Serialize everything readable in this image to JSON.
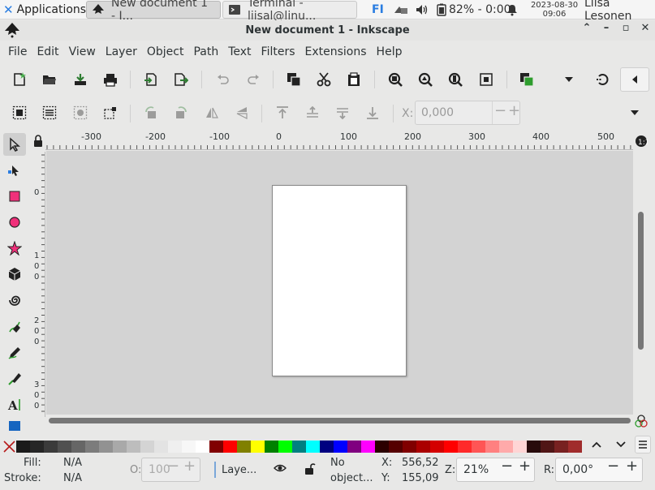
{
  "panel": {
    "apps_label": "Applications",
    "tasks": [
      {
        "label": "New document 1 - I...",
        "active": true
      },
      {
        "label": "Terminal - liisal@linu...",
        "active": false
      }
    ],
    "keyboard_layout": "FI",
    "battery": "82% - 0:00",
    "clock_date": "2023-08-30",
    "clock_time": "09:06",
    "user": "Liisa Lesonen"
  },
  "window": {
    "title": "New document 1 - Inkscape"
  },
  "menubar": [
    "File",
    "Edit",
    "View",
    "Layer",
    "Object",
    "Path",
    "Text",
    "Filters",
    "Extensions",
    "Help"
  ],
  "toolbar2": {
    "x_label": "X:",
    "x_value": "0,000"
  },
  "ruler": {
    "h_ticks": [
      "-300",
      "-200",
      "-100",
      "0",
      "100",
      "200",
      "300",
      "400",
      "500"
    ],
    "v_ticks": [
      "0",
      "1\n0\n0",
      "2\n0\n0",
      "3\n0\n0"
    ]
  },
  "palette": {
    "colors": [
      "#1a1a1a",
      "#262626",
      "#3b3b3b",
      "#505050",
      "#666666",
      "#7c7c7c",
      "#929292",
      "#a9a9a9",
      "#bdbdbd",
      "#d4d4d4",
      "#e3e3e3",
      "#efefef",
      "#f7f7f7",
      "#ffffff",
      "#800000",
      "#ff0000",
      "#808000",
      "#ffff00",
      "#008000",
      "#00ff00",
      "#008080",
      "#00ffff",
      "#000080",
      "#0000ff",
      "#800080",
      "#ff00ff",
      "#2b0000",
      "#550000",
      "#800000",
      "#aa0000",
      "#d40000",
      "#ff0000",
      "#ff2a2a",
      "#ff5555",
      "#ff8080",
      "#ffaaaa",
      "#ffd5d5",
      "#280b0b",
      "#501616",
      "#782121",
      "#a02c2c"
    ]
  },
  "status": {
    "fill_label": "Fill:",
    "fill_value": "N/A",
    "stroke_label": "Stroke:",
    "stroke_value": "N/A",
    "opacity_label": "O:",
    "opacity_value": "100",
    "layer_label": "Laye...",
    "message_line1": "No",
    "message_line2": "object...",
    "x_label": "X:",
    "x_value": "556,52",
    "y_label": "Y:",
    "y_value": "155,09",
    "zoom_label": "Z:",
    "zoom_value": "21%",
    "rotate_label": "R:",
    "rotate_value": "0,00°"
  }
}
